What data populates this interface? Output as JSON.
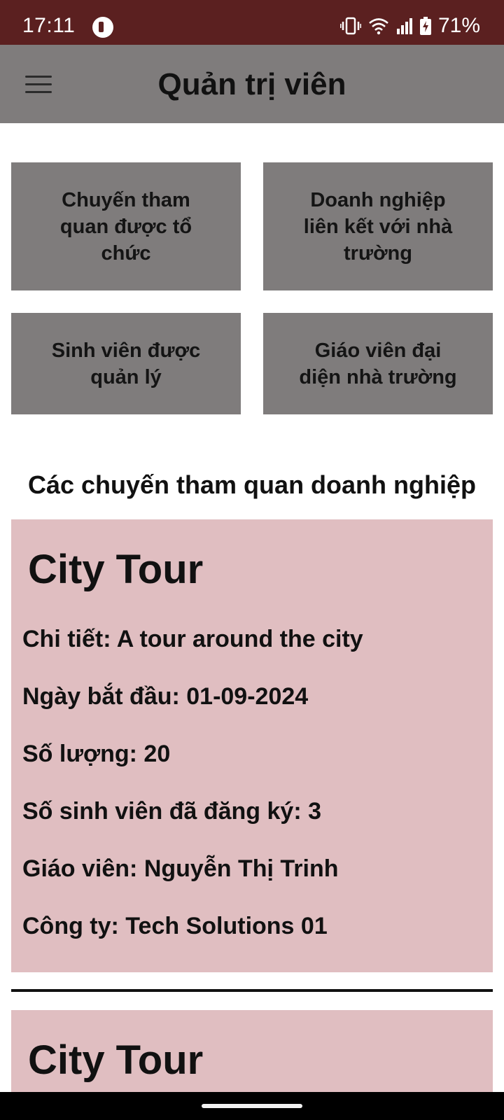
{
  "status_bar": {
    "time": "17:11",
    "battery_percent": "71%",
    "icons": [
      "app-notification-icon",
      "vibrate-icon",
      "wifi-icon",
      "cellular-signal-icon",
      "battery-charging-icon"
    ]
  },
  "app_bar": {
    "title": "Quản trị viên",
    "menu_icon": "hamburger-menu-icon"
  },
  "tiles": [
    "Chuyến tham quan được tổ chức",
    "Doanh nghiệp liên kết với nhà trường",
    "Sinh viên được quản lý",
    "Giáo viên đại diện nhà trường"
  ],
  "section_title": "Các chuyến tham quan doanh nghiệp",
  "tours": [
    {
      "title": "City Tour",
      "details": "Chi tiết: A tour around the city",
      "start_date": "Ngày bắt đầu: 01-09-2024",
      "quantity": "Số lượng: 20",
      "registered": "Số sinh viên đã đăng ký: 3",
      "teacher": "Giáo viên: Nguyễn Thị Trinh",
      "company": "Công ty: Tech Solutions 01"
    },
    {
      "title": "City Tour"
    }
  ],
  "colors": {
    "status_bar": "#5b2020",
    "app_bar": "#7f7c7c",
    "tile": "#7f7c7c",
    "card": "#e0bec1"
  }
}
